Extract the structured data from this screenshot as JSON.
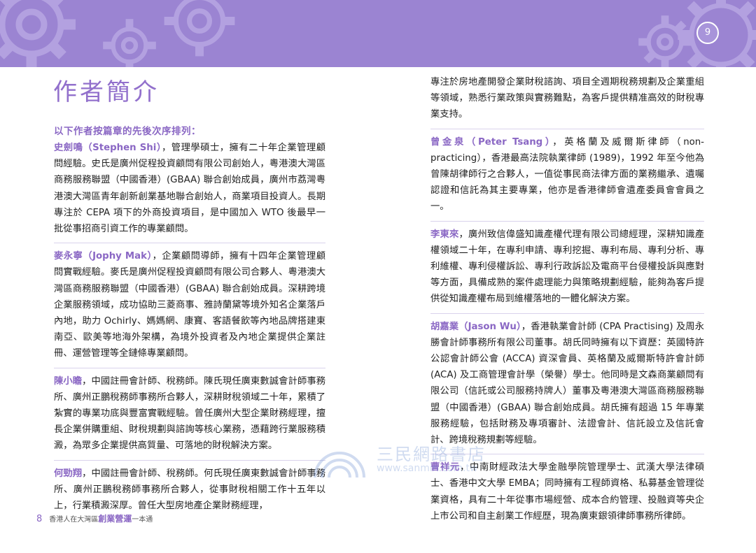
{
  "header": {
    "page_number": "9",
    "colors": {
      "banner": "#9b84d2",
      "accent": "#8a67c4"
    }
  },
  "title": "作者簡介",
  "intro": "以下作者按篇章的先後次序排列：",
  "left_entries": [
    {
      "name": "史劍鳴（Stephen Shi）",
      "text": "，管理學碩士，擁有二十年企業管理顧問經驗。史氏是廣州促程投資顧問有限公司創始人，粵港澳大灣區商務服務聯盟（中國香港）(GBAA) 聯合創始成員，廣州市荔灣粵港澳大灣區青年創新創業基地聯合創始人，商業項目投資人。長期專注於 CEPA 項下的外商投資項目，是中國加入 WTO 後最早一批從事招商引資工作的專業顧問。"
    },
    {
      "name": "麥永寧（Jophy Mak）",
      "text": "，企業顧問導師，擁有十四年企業管理顧問實戰經驗。麥氏是廣州促程投資顧問有限公司合夥人、粵港澳大灣區商務服務聯盟（中國香港）(GBAA) 聯合創始成員。深耕跨境企業服務領域，成功協助三菱商事、雅詩蘭黛等境外知名企業落戶內地，助力 Ochirly、媽媽網、康寶、客語餐飲等內地品牌搭建東南亞、歐美等地海外架構，為境外投資者及內地企業提供企業註冊、運營管理等全鏈條專業顧問。"
    },
    {
      "name": "陳小瞻",
      "text": "，中國註冊會計師、稅務師。陳氏現任廣東數誠會計師事務所、廣州正鵬稅務師事務所合夥人，深耕財稅領域二十年，累積了紮實的專業功底與豐富實戰經驗。曾任廣州大型企業財務經理，擅長企業併購重組、財稅規劃與諮詢等核心業務，憑藉跨行業服務積澱，為眾多企業提供高質量、可落地的財稅解決方案。"
    },
    {
      "name": "何勁翔",
      "text": "，中國註冊會計師、稅務師。何氏現任廣東數誠會計師事務所、廣州正鵬稅務師事務所合夥人，從事財稅相關工作十五年以上，行業積澱深厚。曾任大型房地產企業財務經理，"
    }
  ],
  "right_entries": [
    {
      "name": "",
      "text": "專注於房地產開發企業財稅諮詢、項目全週期稅務規劃及企業重組等領域，熟悉行業政策與實務難點，為客戶提供精准高效的財稅專業支持。"
    },
    {
      "name": "曾金泉（Peter Tsang）",
      "text": "，英格蘭及威爾斯律師（non-practicing），香港最高法院執業律師 (1989)，1992 年至今他為曾陳胡律師行之合夥人，一值從事民商法律方面的業務繼承、遺囑認證和信託為其主要專業，他亦是香港律師會遺產委員會會員之一。"
    },
    {
      "name": "李東來",
      "text": "，廣州致信偉盛知識產權代理有限公司總經理，深耕知識產權領域二十年，在專利申請、專利挖掘、專利布局、專利分析、專利維權、專利侵權訴訟、專利行政訴訟及電商平台侵權投訴與應對等方面，具備成熟的案件處理能力與策略規劃經驗，能夠為客戶提供從知識產權布局到維權落地的一體化解決方案。"
    },
    {
      "name": "胡嘉業（Jason Wu）",
      "text": "，香港執業會計師 (CPA Practising) 及周永勝會計師事務所有限公司董事。胡氏同時擁有以下資歷：英國特許公認會計師公會 (ACCA) 資深會員、英格蘭及威爾斯特許會計師 (ACA) 及工商管理會計學（榮譽）學士。他同時是文森商業顧問有限公司（信託或公司服務持牌人）董事及粵港澳大灣區商務服務聯盟（中國香港）(GBAA) 聯合創始成員。胡氏擁有超過 15 年專業服務經驗，包括財務及專項審計、法證會計、信託設立及信託會計、跨境稅務規劃等經驗。"
    },
    {
      "name": "曹祥元",
      "text": "，中南財經政法大學金融學院管理學士、武漢大學法律碩士、香港中文大學 EMBA；同時擁有工程師資格、私募基金管理從業資格，具有二十年從事市場經營、成本合約管理、投融資等央企上市公司和自主創業工作經歷，現為廣東銀領律師事務所律師。"
    }
  ],
  "footer": {
    "page_number": "8",
    "book_prefix": "香港人在大灣區",
    "book_highlight": "創業營運",
    "book_suffix": "一本通"
  },
  "watermark": {
    "text": "三民網路書店",
    "url": "www.sanmin.com.tw"
  }
}
